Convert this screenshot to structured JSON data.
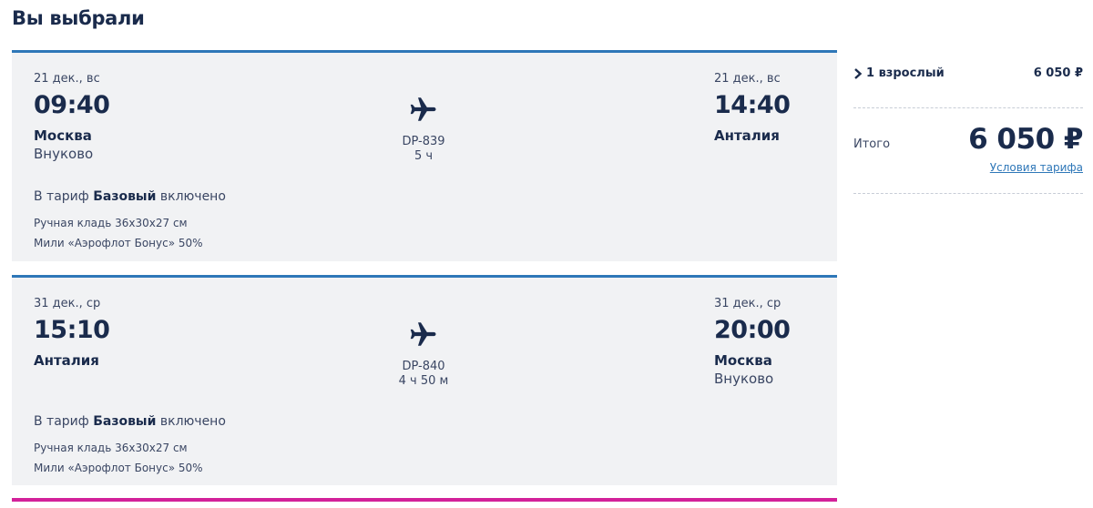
{
  "page": {
    "title": "Вы выбрали"
  },
  "flights": [
    {
      "departure": {
        "date": "21 дек., вс",
        "time": "09:40",
        "city": "Москва",
        "airport": "Внуково"
      },
      "arrival": {
        "date": "21 дек., вс",
        "time": "14:40",
        "city": "Анталия",
        "airport": ""
      },
      "flight_number": "DP-839",
      "duration": "5 ч",
      "tariff_prefix": "В тариф",
      "tariff_name": "Базовый",
      "tariff_suffix": "включено",
      "features": [
        "Ручная кладь 36x30x27 см",
        "Мили «Аэрофлот Бонус» 50%"
      ],
      "icon": "plane-icon"
    },
    {
      "departure": {
        "date": "31 дек., ср",
        "time": "15:10",
        "city": "Анталия",
        "airport": ""
      },
      "arrival": {
        "date": "31 дек., ср",
        "time": "20:00",
        "city": "Москва",
        "airport": "Внуково"
      },
      "flight_number": "DP-840",
      "duration": "4 ч 50 м",
      "tariff_prefix": "В тариф",
      "tariff_name": "Базовый",
      "tariff_suffix": "включено",
      "features": [
        "Ручная кладь 36x30x27 см",
        "Мили «Аэрофлот Бонус» 50%"
      ],
      "icon": "plane-icon"
    }
  ],
  "summary": {
    "passenger_label": "1 взрослый",
    "passenger_price": "6 050 ₽",
    "total_label": "Итого",
    "total_value": "6 050 ₽",
    "tariff_link": "Условия тарифа"
  },
  "colors": {
    "primary_text": "#1a2b4c",
    "accent_blue": "#2e77b8",
    "accent_pink": "#d3219a",
    "card_background": "#f1f2f4"
  }
}
